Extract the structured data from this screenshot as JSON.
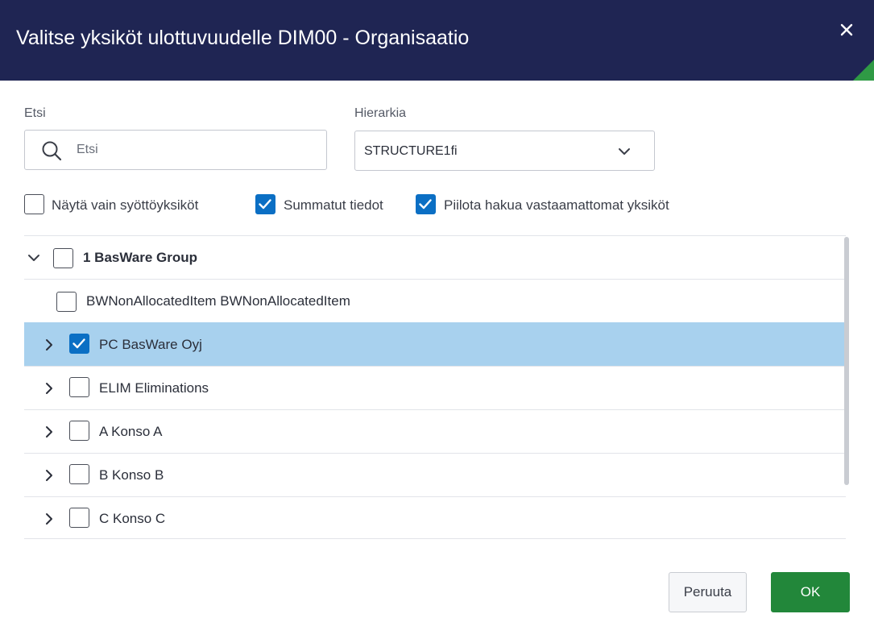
{
  "dialog": {
    "title": "Valitse yksiköt ulottuvuudelle DIM00 - Organisaatio",
    "close_icon": "close-icon",
    "header_color": "#1f2553",
    "accent_color": "#2f9a45"
  },
  "search": {
    "label": "Etsi",
    "placeholder": "Etsi",
    "value": ""
  },
  "hierarchy": {
    "label": "Hierarkia",
    "selected": "STRUCTURE1fi"
  },
  "options": [
    {
      "label": "Näytä vain syöttöyksiköt",
      "checked": false
    },
    {
      "label": "Summatut tiedot",
      "checked": true
    },
    {
      "label": "Piilota hakua vastaamattomat yksiköt",
      "checked": true
    }
  ],
  "tree": {
    "rows": [
      {
        "label": "1 BasWare Group",
        "checked": false,
        "expander": "expanded",
        "bold": true,
        "selected": false
      },
      {
        "label": "BWNonAllocatedItem BWNonAllocatedItem",
        "checked": false,
        "expander": "none",
        "bold": false,
        "selected": false
      },
      {
        "label": "PC BasWare Oyj",
        "checked": true,
        "expander": "collapsed",
        "bold": false,
        "selected": true
      },
      {
        "label": "ELIM Eliminations",
        "checked": false,
        "expander": "collapsed",
        "bold": false,
        "selected": false
      },
      {
        "label": "A Konso A",
        "checked": false,
        "expander": "collapsed",
        "bold": false,
        "selected": false
      },
      {
        "label": "B Konso B",
        "checked": false,
        "expander": "collapsed",
        "bold": false,
        "selected": false
      },
      {
        "label": "C Konso C",
        "checked": false,
        "expander": "collapsed",
        "bold": false,
        "selected": false
      }
    ],
    "selected_row_color": "#a8d1ee"
  },
  "buttons": {
    "cancel": "Peruuta",
    "ok": "OK",
    "ok_color": "#22873a"
  }
}
